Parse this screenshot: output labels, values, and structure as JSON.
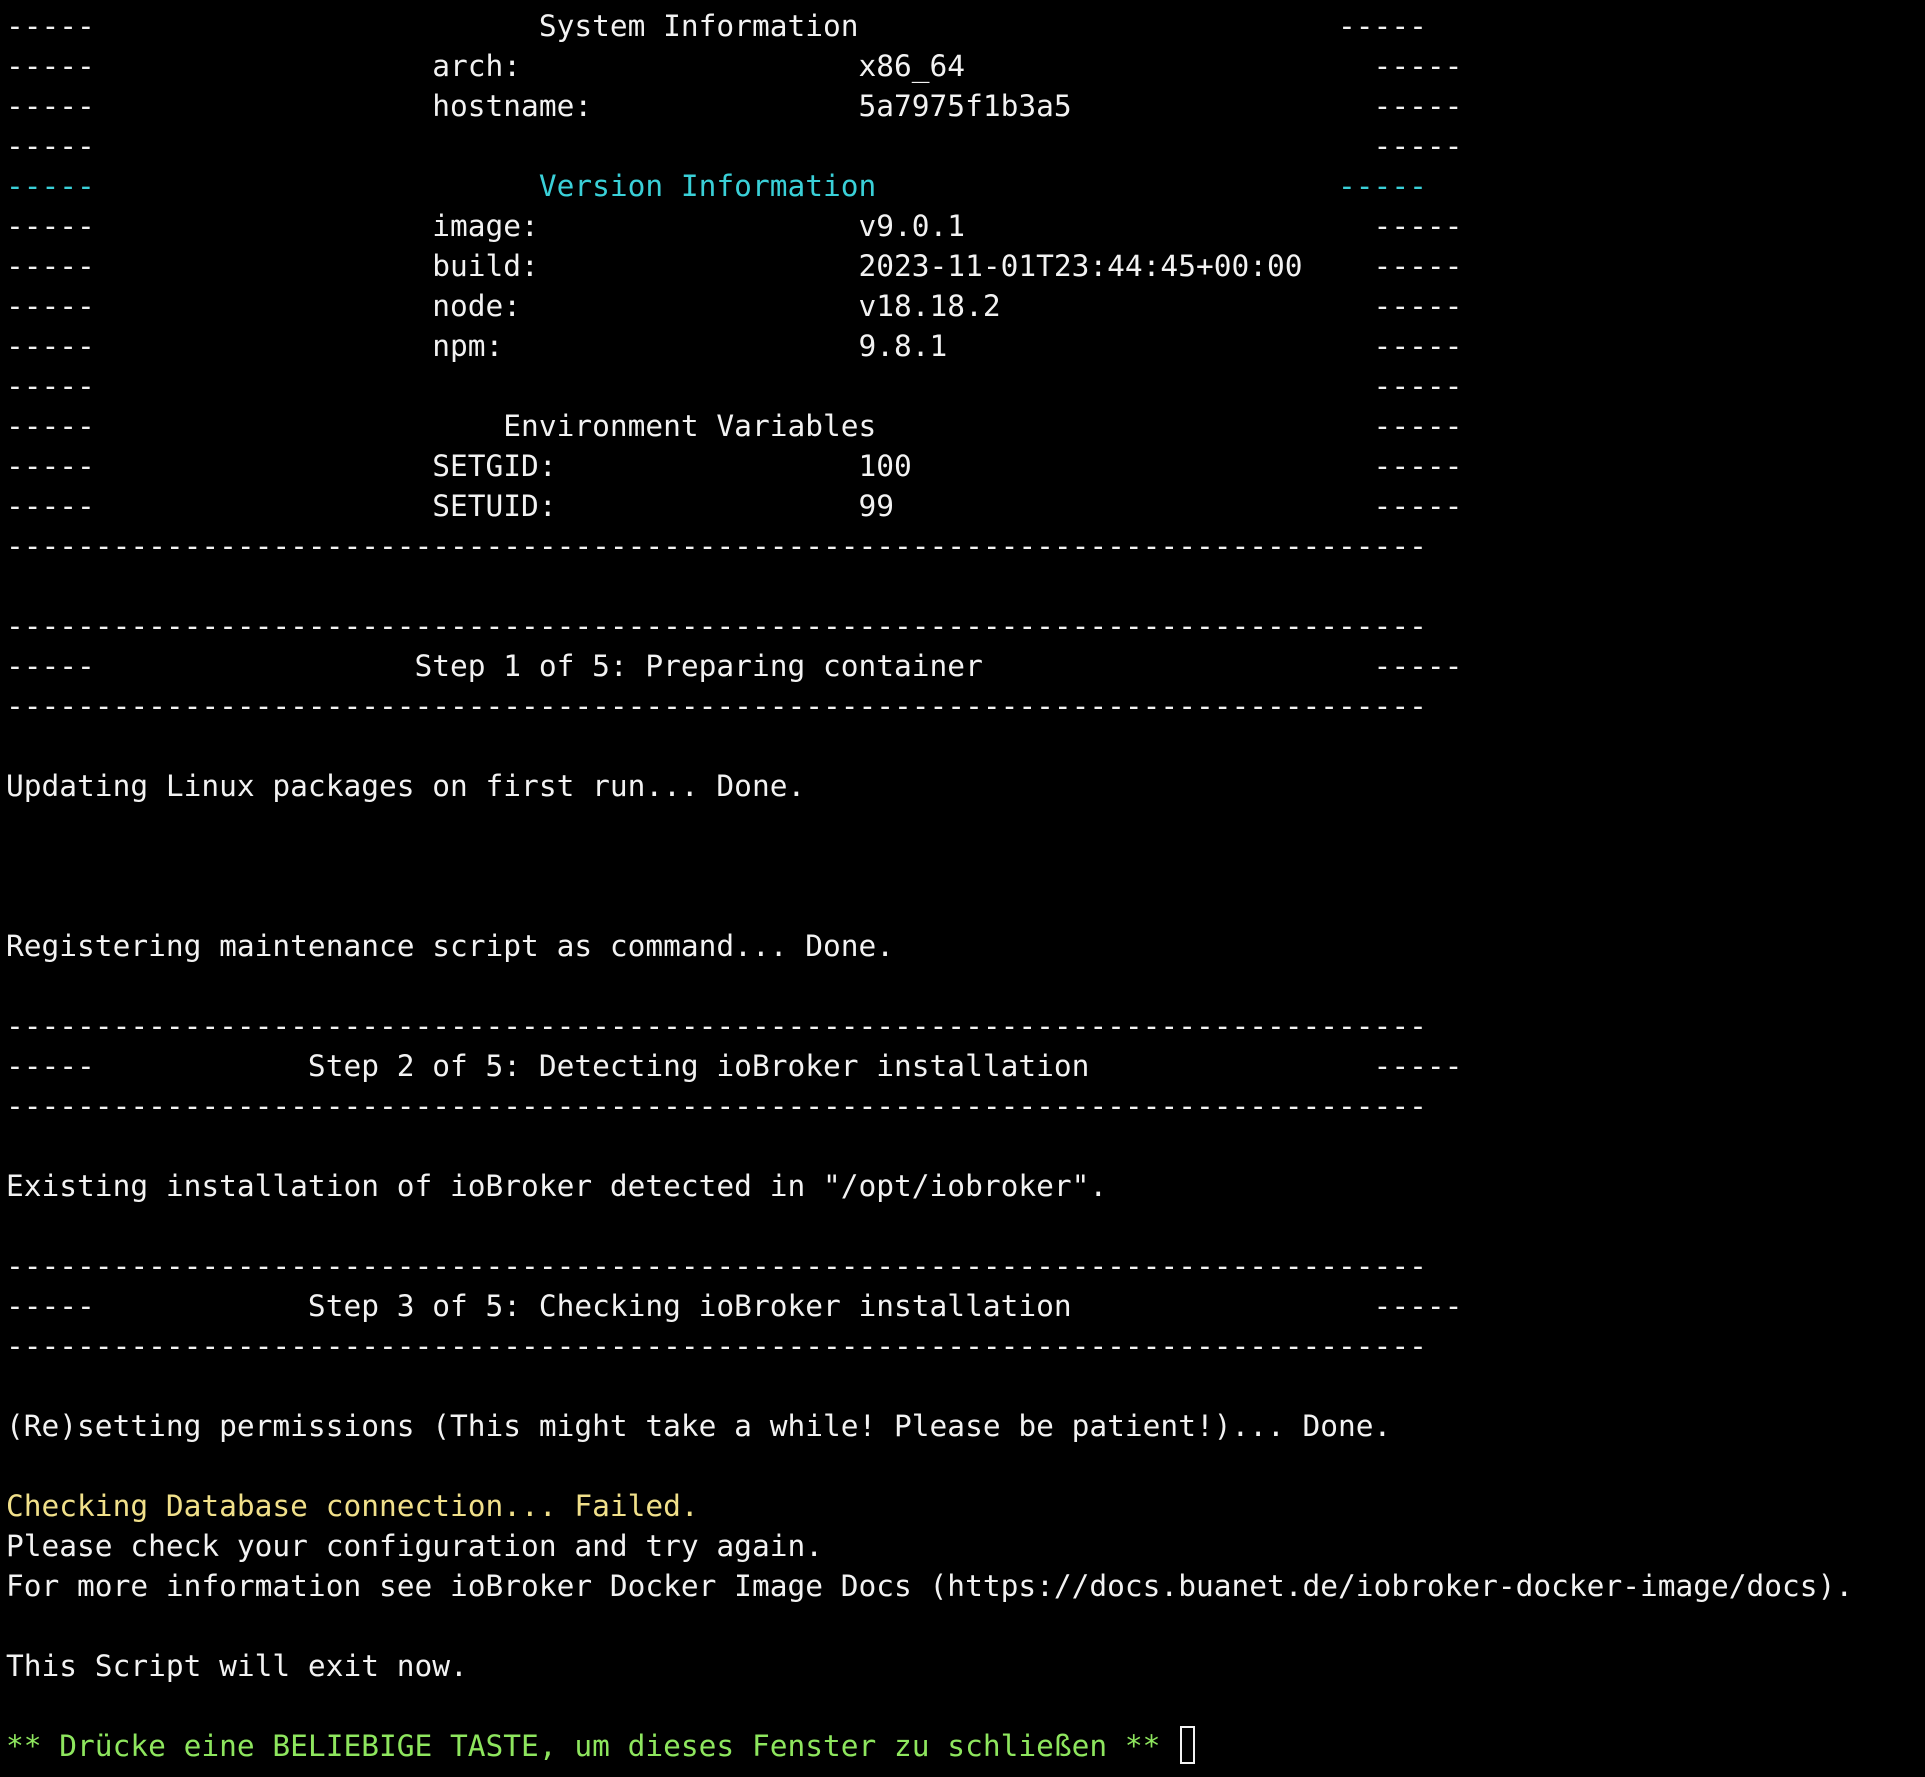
{
  "terminal": {
    "colors": {
      "background": "#000000",
      "default": "#f2f2f2",
      "cyan": "#3ad0d8",
      "yellow": "#f1e08a",
      "green": "#8ee65e"
    },
    "lines": [
      {
        "text": "-----                         System Information                           -----",
        "color": "default"
      },
      {
        "text": "-----                   arch:                   x86_64                       -----",
        "color": "default"
      },
      {
        "text": "-----                   hostname:               5a7975f1b3a5                 -----",
        "color": "default"
      },
      {
        "text": "-----                                                                        -----",
        "color": "default"
      },
      {
        "text": "-----                         Version Information                          -----",
        "color": "cyan"
      },
      {
        "text": "-----                   image:                  v9.0.1                       -----",
        "color": "default"
      },
      {
        "text": "-----                   build:                  2023-11-01T23:44:45+00:00    -----",
        "color": "default"
      },
      {
        "text": "-----                   node:                   v18.18.2                     -----",
        "color": "default"
      },
      {
        "text": "-----                   npm:                    9.8.1                        -----",
        "color": "default"
      },
      {
        "text": "-----                                                                        -----",
        "color": "default"
      },
      {
        "text": "-----                       Environment Variables                            -----",
        "color": "default"
      },
      {
        "text": "-----                   SETGID:                 100                          -----",
        "color": "default"
      },
      {
        "text": "-----                   SETUID:                 99                           -----",
        "color": "default"
      },
      {
        "text": "--------------------------------------------------------------------------------",
        "color": "default"
      },
      {
        "text": "",
        "color": "default"
      },
      {
        "text": "--------------------------------------------------------------------------------",
        "color": "default"
      },
      {
        "text": "-----                  Step 1 of 5: Preparing container                      -----",
        "color": "default"
      },
      {
        "text": "--------------------------------------------------------------------------------",
        "color": "default"
      },
      {
        "text": "",
        "color": "default"
      },
      {
        "text": "Updating Linux packages on first run... Done.",
        "color": "default"
      },
      {
        "text": "",
        "color": "default"
      },
      {
        "text": "",
        "color": "default"
      },
      {
        "text": "",
        "color": "default"
      },
      {
        "text": "Registering maintenance script as command... Done.",
        "color": "default"
      },
      {
        "text": "",
        "color": "default"
      },
      {
        "text": "--------------------------------------------------------------------------------",
        "color": "default"
      },
      {
        "text": "-----            Step 2 of 5: Detecting ioBroker installation                -----",
        "color": "default"
      },
      {
        "text": "--------------------------------------------------------------------------------",
        "color": "default"
      },
      {
        "text": "",
        "color": "default"
      },
      {
        "text": "Existing installation of ioBroker detected in \"/opt/iobroker\".",
        "color": "default"
      },
      {
        "text": "",
        "color": "default"
      },
      {
        "text": "--------------------------------------------------------------------------------",
        "color": "default"
      },
      {
        "text": "-----            Step 3 of 5: Checking ioBroker installation                 -----",
        "color": "default"
      },
      {
        "text": "--------------------------------------------------------------------------------",
        "color": "default"
      },
      {
        "text": "",
        "color": "default"
      },
      {
        "text": "(Re)setting permissions (This might take a while! Please be patient!)... Done.",
        "color": "default"
      },
      {
        "text": "",
        "color": "default"
      },
      {
        "text": "Checking Database connection... Failed.",
        "color": "yellow"
      },
      {
        "text": "Please check your configuration and try again.",
        "color": "default"
      },
      {
        "text": "For more information see ioBroker Docker Image Docs (https://docs.buanet.de/iobroker-docker-image/docs).",
        "color": "default"
      },
      {
        "text": "",
        "color": "default"
      },
      {
        "text": "This Script will exit now.",
        "color": "default"
      },
      {
        "text": "",
        "color": "default"
      },
      {
        "text": "** Drücke eine BELIEBIGE TASTE, um dieses Fenster zu schließen ** ",
        "color": "green",
        "cursor": true
      }
    ]
  }
}
